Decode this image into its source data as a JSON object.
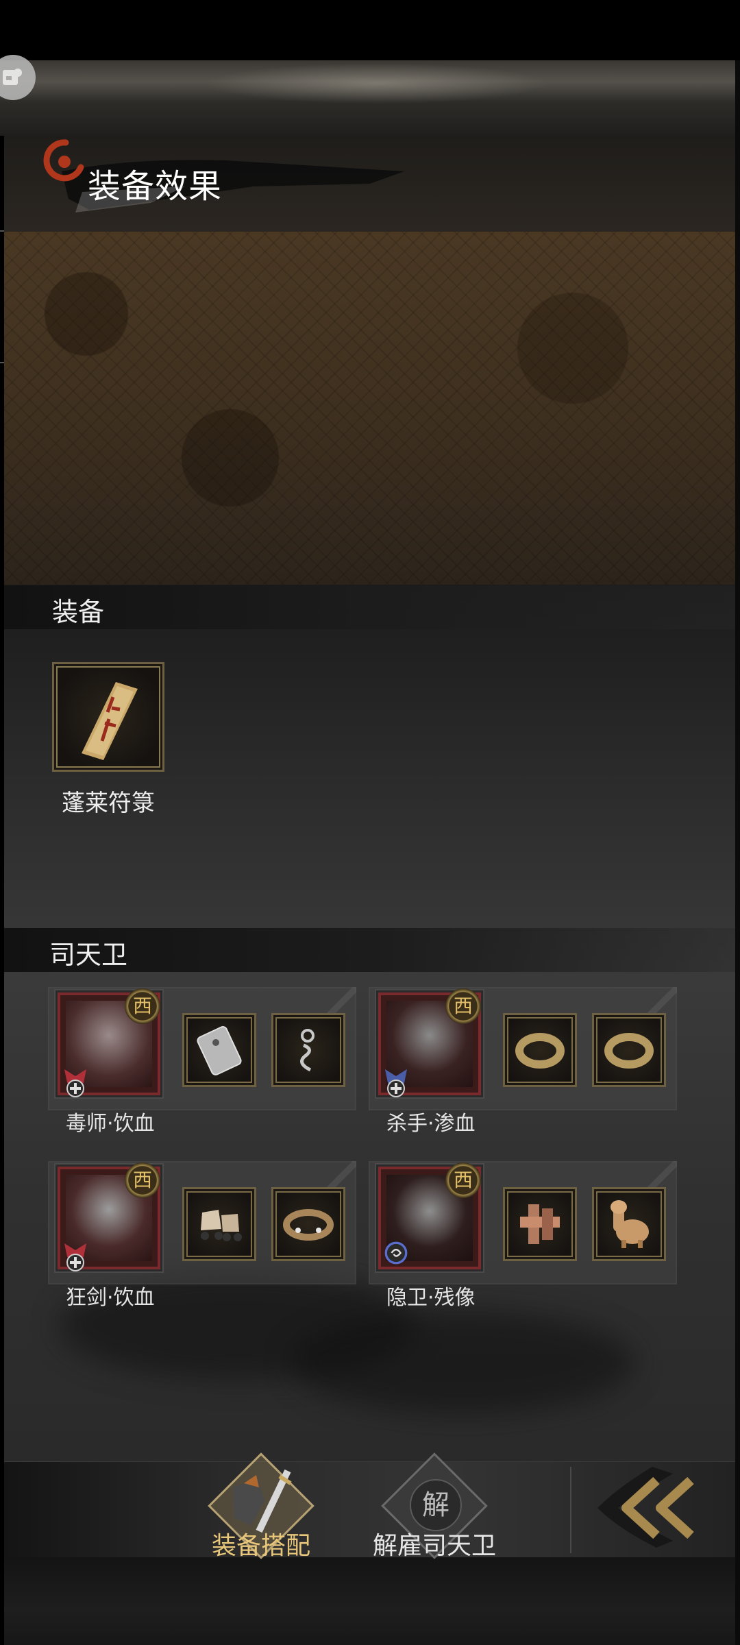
{
  "header": {
    "title": "装备效果"
  },
  "equipment_section": {
    "label": "装备",
    "items": [
      {
        "name": "蓬莱符箓"
      }
    ]
  },
  "guards_section": {
    "label": "司天卫",
    "characters": [
      {
        "name": "毒师·饮血",
        "badge": "西",
        "emblem": "red-cross-emblem-icon",
        "slots": [
          "silver-plate-charm-icon",
          "serpent-pendant-icon"
        ]
      },
      {
        "name": "杀手·渗血",
        "badge": "西",
        "emblem": "blue-cross-emblem-icon",
        "slots": [
          "gold-ring-icon",
          "gold-ring-icon"
        ]
      },
      {
        "name": "狂剑·饮血",
        "badge": "西",
        "emblem": "red-cross-emblem-icon",
        "slots": [
          "roller-skates-icon",
          "jeweled-bracelet-icon"
        ]
      },
      {
        "name": "隐卫·残像",
        "badge": "西",
        "emblem": "blue-swirl-emblem-icon",
        "slots": [
          "wooden-puzzle-cube-icon",
          "alpaca-plush-icon"
        ]
      }
    ]
  },
  "bottom_nav": {
    "equip_match": {
      "label": "装备搭配",
      "color": "#e8c77a"
    },
    "dismiss": {
      "label": "解雇司天卫",
      "glyph": "解",
      "color": "#e6e6e6"
    },
    "back": {
      "icon": "double-chevron-left-icon"
    }
  },
  "colors": {
    "accent_gold": "#e8c77a",
    "frame_gold": "#6e6142",
    "portrait_red": "#7a2a2c"
  }
}
